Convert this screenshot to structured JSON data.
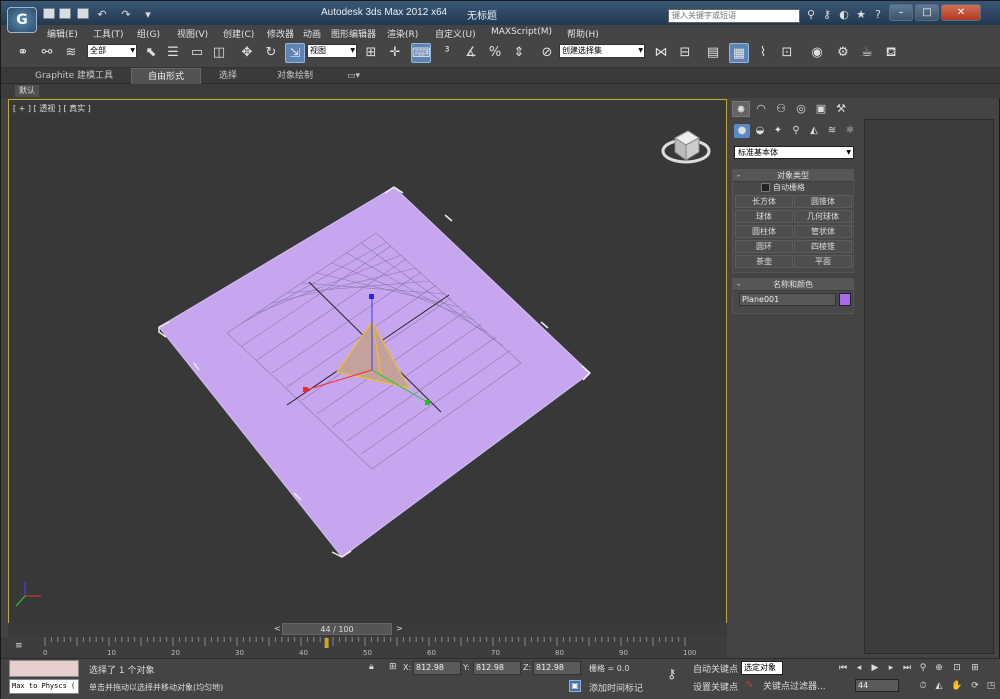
{
  "window": {
    "title": "Autodesk 3ds Max  2012 x64",
    "document": "无标题",
    "search_placeholder": "键入关键字或短语"
  },
  "menu": [
    "编辑(E)",
    "工具(T)",
    "组(G)",
    "视图(V)",
    "创建(C)",
    "修改器",
    "动画",
    "图形编辑器",
    "渲染(R)",
    "自定义(U)",
    "MAXScript(M)",
    "帮助(H)"
  ],
  "toolbar": {
    "selection_filter": "全部",
    "ref_coord": "视图",
    "named_selection": "创建选择集"
  },
  "ribbon": {
    "tabs": [
      "Graphite 建模工具",
      "自由形式",
      "选择",
      "对象绘制"
    ],
    "selected_tab": "自由形式",
    "default_label": "默认"
  },
  "viewport": {
    "label": "[ + ] [ 透视 ] [ 真实 ]"
  },
  "command_panel": {
    "category": "标准基本体",
    "object_type": {
      "title": "对象类型",
      "autogrid": "自动栅格",
      "buttons": [
        "长方体",
        "圆锥体",
        "球体",
        "几何球体",
        "圆柱体",
        "管状体",
        "圆环",
        "四棱锥",
        "茶壶",
        "平面"
      ]
    },
    "name_color": {
      "title": "名称和颜色",
      "name": "Plane001",
      "color": "#a86ae8"
    }
  },
  "timeline": {
    "slider": "44 / 100",
    "ticks": [
      "0",
      "10",
      "20",
      "30",
      "40",
      "50",
      "60",
      "70",
      "80",
      "90",
      "100"
    ]
  },
  "status": {
    "maxscript": "Max to Physcs (",
    "selected": "选择了 1 个对象",
    "hint": "单击并拖动以选择并移动对象(均匀地)",
    "x_label": "X:",
    "y_label": "Y:",
    "z_label": "Z:",
    "x": "812.98",
    "y": "812.98",
    "z": "812.98",
    "grid": "栅格 = 0.0",
    "add_time_tag": "添加时间标记",
    "auto_key": "自动关键点",
    "set_key": "设置关键点",
    "selection": "选定对象",
    "key_filters": "关键点过滤器...",
    "frame": "44"
  },
  "colors": {
    "plane": "#c7a6f0",
    "accent": "#5f84b4",
    "viewport_border": "#c4a636"
  }
}
